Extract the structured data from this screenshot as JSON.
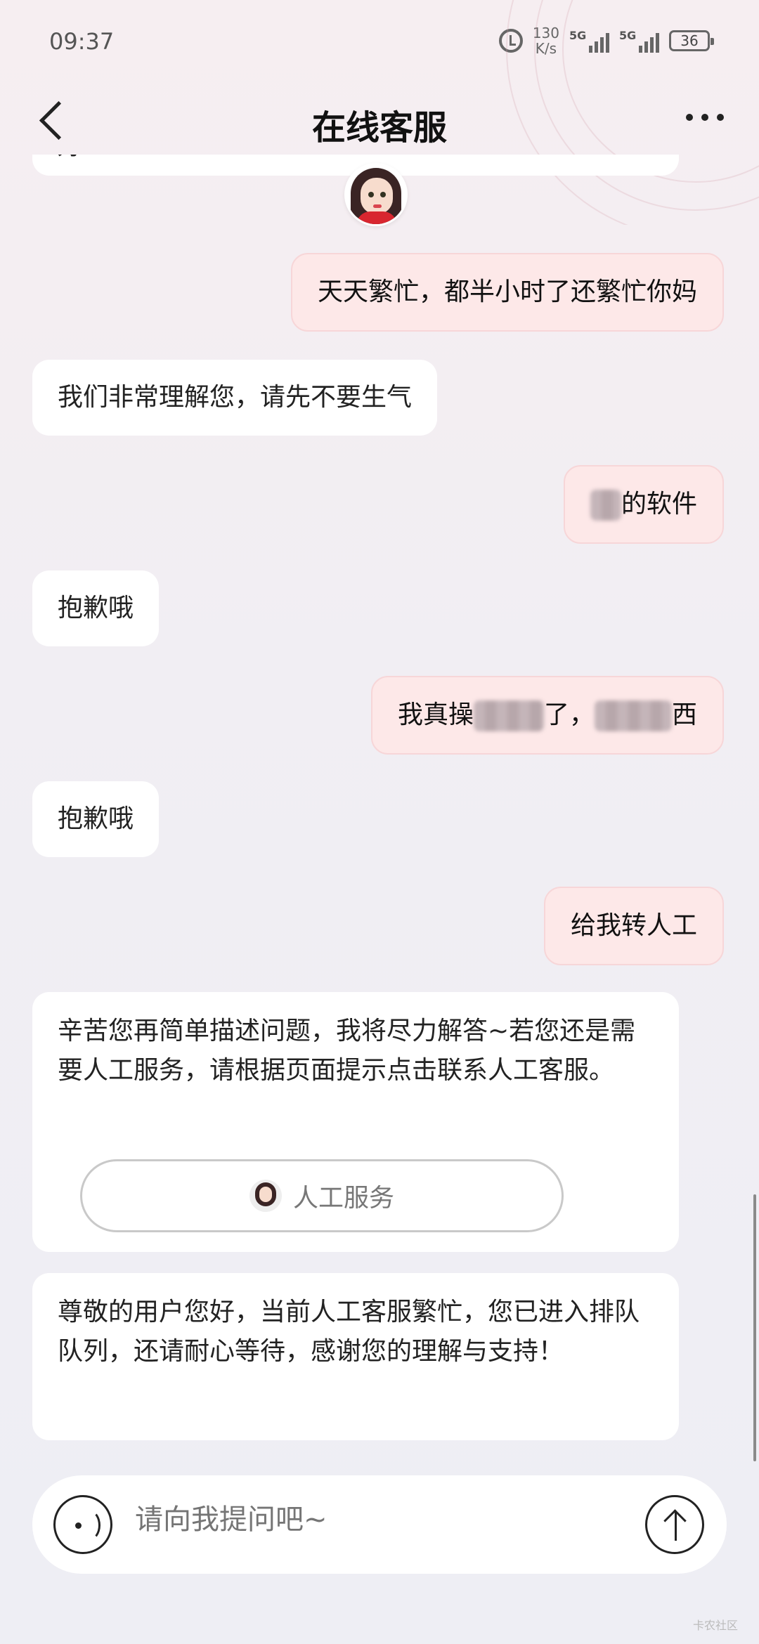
{
  "status_bar": {
    "time": "09:37",
    "net_speed_value": "130",
    "net_speed_unit": "K/s",
    "signal1": "5G",
    "signal2": "5G",
    "battery": "36"
  },
  "header": {
    "title": "在线客服"
  },
  "messages": [
    {
      "role": "bot",
      "text": "好!"
    },
    {
      "role": "user",
      "text": "天天繁忙，都半小时了还繁忙你妈"
    },
    {
      "role": "bot",
      "text": "我们非常理解您，请先不要生气"
    },
    {
      "role": "user",
      "text": "的软件"
    },
    {
      "role": "bot",
      "text": "抱歉哦"
    },
    {
      "role": "user",
      "text_a": "我真操",
      "text_b": "了，",
      "text_c": "西"
    },
    {
      "role": "bot",
      "text": "抱歉哦"
    },
    {
      "role": "user",
      "text": "给我转人工"
    },
    {
      "role": "bot",
      "text": "辛苦您再简单描述问题，我将尽力解答~若您还是需要人工服务，请根据页面提示点击联系人工客服。",
      "button_label": "人工服务"
    },
    {
      "role": "bot",
      "text": "尊敬的用户您好，当前人工客服繁忙，您已进入排队队列，还请耐心等待，感谢您的理解与支持！"
    }
  ],
  "input": {
    "placeholder": "请向我提问吧~"
  },
  "icons": {
    "back": "back-arrow-icon",
    "more": "more-icon",
    "voice": "voice-icon",
    "send": "send-arrow-icon"
  },
  "colors": {
    "user_bubble": "#fde8e8",
    "bot_bubble": "#ffffff",
    "accent": "#d8262f"
  },
  "watermark": "卡农社区"
}
